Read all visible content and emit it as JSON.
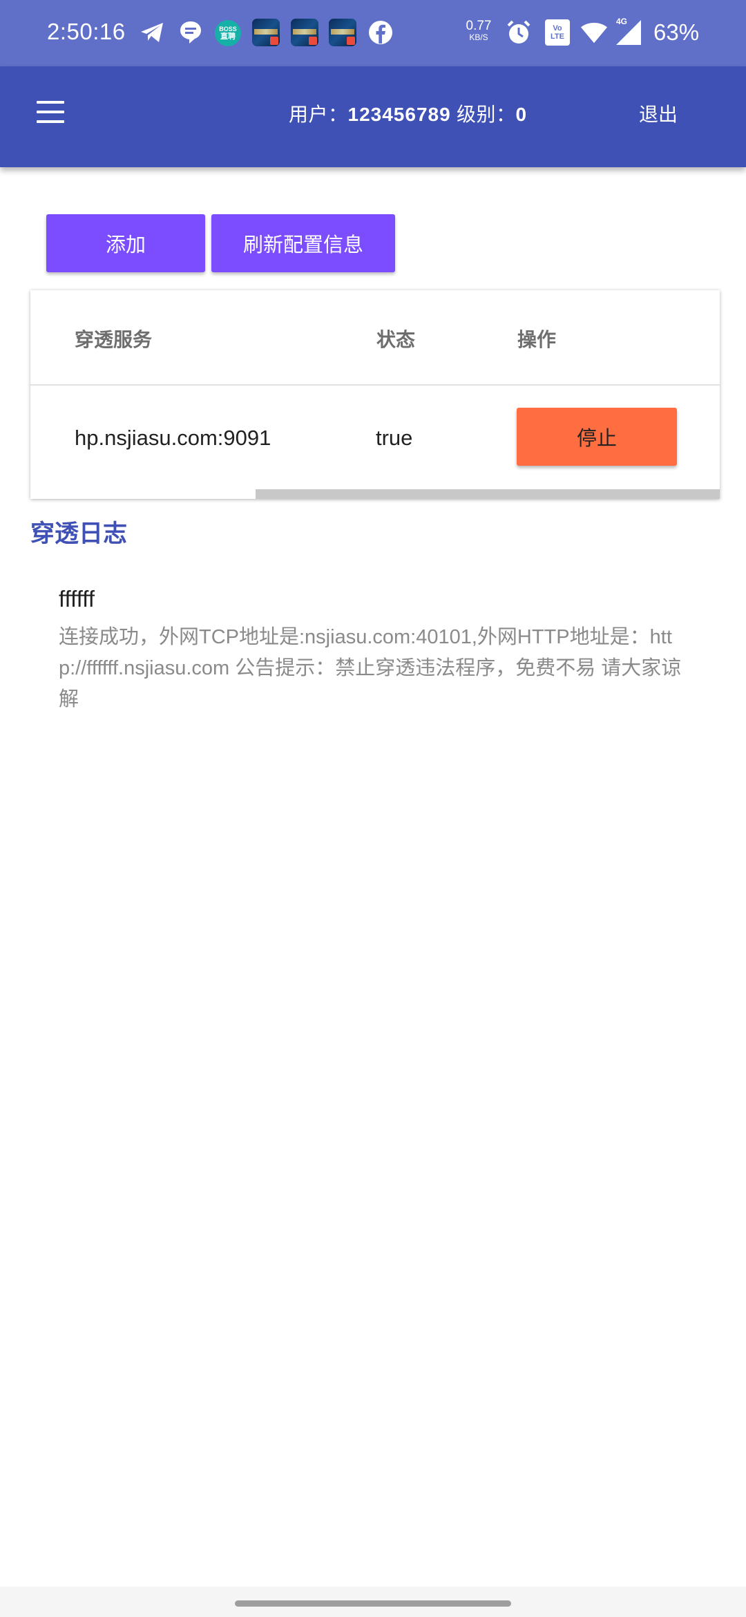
{
  "status_bar": {
    "time": "2:50:16",
    "notification_icons": [
      "telegram-icon",
      "message-bubble-icon",
      "boss-zhipin-icon",
      "game-app-icon",
      "game-app-icon",
      "game-app-icon",
      "facebook-icon"
    ],
    "boss_line1": "BOSS",
    "boss_line2": "直聘",
    "net_speed_value": "0.77",
    "net_speed_unit": "KB/S",
    "system_icons": [
      "alarm-icon",
      "volte-icon",
      "wifi-icon",
      "signal-4g-icon"
    ],
    "volte_label": "Vo LTE",
    "network_label": "4G",
    "battery": "63%"
  },
  "app_bar": {
    "user_label": "用户：",
    "user_id": "123456789",
    "level_label": " 级别：",
    "level_value": "0",
    "logout_label": "退出"
  },
  "actions": {
    "add_label": "添加",
    "refresh_label": "刷新配置信息"
  },
  "table": {
    "columns": [
      "穿透服务",
      "状态",
      "操作"
    ],
    "rows": [
      {
        "service": "hp.nsjiasu.com:9091",
        "status": "true",
        "action_label": "停止"
      }
    ]
  },
  "log": {
    "title": "穿透日志",
    "entries": [
      {
        "name": "ffffff",
        "message": "连接成功，外网TCP地址是:nsjiasu.com:40101,外网HTTP地址是：http://ffffff.nsjiasu.com 公告提示：禁止穿透违法程序，免费不易 请大家谅解"
      }
    ]
  },
  "colors": {
    "status_bar": "#6070c8",
    "app_bar": "#3f51b5",
    "primary_button": "#7c4dff",
    "stop_button": "#ff6e40",
    "log_title": "#3f51b5"
  }
}
